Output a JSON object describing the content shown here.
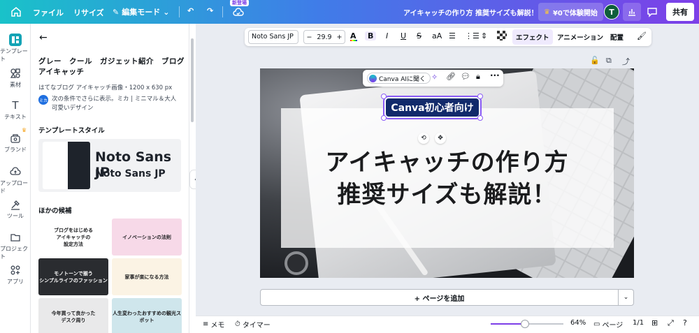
{
  "topbar": {
    "file": "ファイル",
    "resize": "リサイズ",
    "edit_mode": "編集モード",
    "new_badge": "新登場",
    "doc_title": "アイキャッチの作り方 推奨サイズも解説！",
    "trial": "¥0で体験開始",
    "avatar": "T",
    "share": "共有"
  },
  "rail": [
    {
      "label": "テンプレート",
      "icon": "template-icon"
    },
    {
      "label": "素材",
      "icon": "elements-icon"
    },
    {
      "label": "テキスト",
      "icon": "text-icon"
    },
    {
      "label": "ブランド",
      "icon": "brand-icon"
    },
    {
      "label": "アップロード",
      "icon": "upload-icon"
    },
    {
      "label": "ツール",
      "icon": "tools-icon"
    },
    {
      "label": "プロジェクト",
      "icon": "projects-icon"
    },
    {
      "label": "アプリ",
      "icon": "apps-icon"
    }
  ],
  "panel": {
    "title": "グレー　クール　ガジェット紹介　ブログ　アイキャッチ",
    "meta": "はてなブログ アイキャッチ画像・1200 x 630 px",
    "author_badge": "ミカ",
    "author_text": "次の条件でさらに表示。ミカ | ミニマル＆大人可愛いデザイン",
    "style_heading": "テンプレートスタイル",
    "font_large": "Noto Sans JP",
    "font_small": "Noto Sans JP",
    "others_heading": "ほかの候補",
    "thumbs": [
      {
        "text": "ブログをはじめる\nアイキャッチの\n設定方法",
        "bg": "#ffffff",
        "fg": "#1b1c1e"
      },
      {
        "text": "イノベーションの法則",
        "bg": "#f7d9e8",
        "fg": "#1b1c1e"
      },
      {
        "text": "モノトーンで揃う\nシンプルライフのファッション",
        "bg": "#2a2c30",
        "fg": "#ffffff"
      },
      {
        "text": "家事が楽になる方法",
        "bg": "#fbf3e4",
        "fg": "#1b1c1e"
      },
      {
        "text": "今年買って良かった\nデスク周り",
        "bg": "#e9e9ea",
        "fg": "#1b1c1e"
      },
      {
        "text": "人生変わったおすすめの観光スポット",
        "bg": "#cfe6ec",
        "fg": "#1b1c1e"
      }
    ]
  },
  "toolbar": {
    "font": "Noto Sans JP",
    "size": "29.9",
    "minus": "−",
    "plus": "+",
    "bold": "B",
    "italic": "I",
    "underline": "U",
    "strike": "S",
    "case": "aA",
    "effect": "エフェクト",
    "animation": "アニメーション",
    "position": "配置"
  },
  "canvas": {
    "ai_ask": "Canva AIに聞く",
    "badge": "Canva初心者向け",
    "headline_1": "アイキャッチの作り方",
    "headline_2": "推奨サイズも解説！",
    "add_page": "+ ページを追加"
  },
  "bottombar": {
    "memo": "メモ",
    "timer": "タイマー",
    "zoom": "64%",
    "zoom_value": 0.47,
    "page": "ページ",
    "page_count": "1/1"
  }
}
